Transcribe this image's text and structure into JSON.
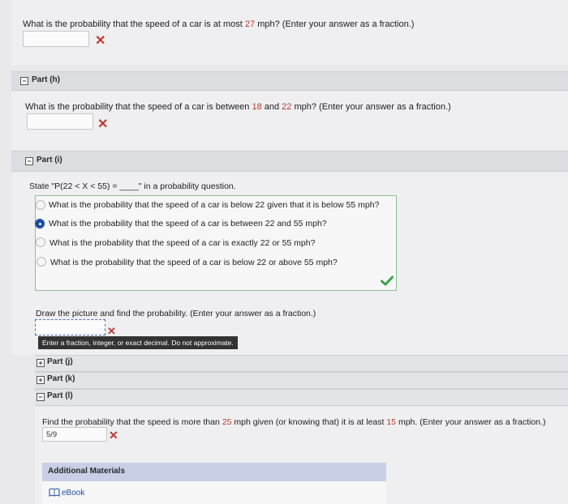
{
  "part_g": {
    "question_pre": "What is the probability that the speed of a car is at most ",
    "question_num": "27",
    "question_post": " mph? (Enter your answer as a fraction.)",
    "result_icon": "cross-mark-icon"
  },
  "part_h": {
    "label": "Part (h)",
    "toggle": "−",
    "question_pre": "What is the probability that the speed of a car is between ",
    "num1": "18",
    "mid": " and ",
    "num2": "22",
    "question_post": " mph? (Enter your answer as a fraction.)",
    "result_icon": "cross-mark-icon"
  },
  "part_i": {
    "label": "Part (i)",
    "toggle": "−",
    "prompt": "State \"P(22 < X < 55) = ____\" in a probability question.",
    "options": [
      "What is the probability that the speed of a car is below 22 given that it is below 55 mph?",
      "What is the probability that the speed of a car is between 22 and 55 mph?",
      "What is the probability that the speed of a car is exactly 22 or 55 mph?",
      "What is the probability that the speed of a car is below 22 or above 55 mph?"
    ],
    "selected_index": 1,
    "check_icon": "check-mark-icon",
    "draw_prompt": "Draw the picture and find the probability. (Enter your answer as a fraction.)",
    "tooltip": "Enter a fraction, integer, or exact decimal. Do not approximate."
  },
  "part_j": {
    "label": "Part (j)",
    "toggle": "+"
  },
  "part_k": {
    "label": "Part (k)",
    "toggle": "+"
  },
  "part_l": {
    "label": "Part (l)",
    "toggle": "−",
    "question_pre": "Find the probability that the speed is more than ",
    "num1": "25",
    "mid": " mph given (or knowing that) it is at least ",
    "num2": "15",
    "question_post": " mph. (Enter your answer as a fraction.)",
    "answer_value": "5/9",
    "result_icon": "cross-mark-icon"
  },
  "additional": {
    "title": "Additional Materials",
    "ebook_label": "eBook"
  },
  "colors": {
    "wrong": "#c0392b",
    "correct": "#3aa34a",
    "selected": "#1f4ea3",
    "tooltip_bg": "#333333"
  }
}
